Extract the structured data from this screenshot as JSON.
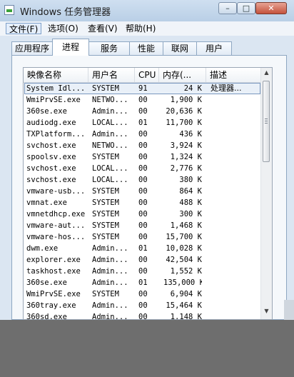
{
  "window": {
    "title": "Windows 任务管理器",
    "controls": {
      "minimize": "–",
      "maximize": "□",
      "close": "✕"
    }
  },
  "menu": [
    {
      "label": "文件(F)"
    },
    {
      "label": "选项(O)"
    },
    {
      "label": "查看(V)"
    },
    {
      "label": "帮助(H)"
    }
  ],
  "tabs": [
    {
      "label": "应用程序"
    },
    {
      "label": "进程"
    },
    {
      "label": "服务"
    },
    {
      "label": "性能"
    },
    {
      "label": "联网"
    },
    {
      "label": "用户"
    }
  ],
  "selected_tab": "进程",
  "columns": [
    {
      "label": "映像名称"
    },
    {
      "label": "用户名"
    },
    {
      "label": "CPU"
    },
    {
      "label": "内存(..."
    },
    {
      "label": "描述"
    }
  ],
  "processes": [
    {
      "name": "System Idl...",
      "user": "SYSTEM",
      "cpu": "91",
      "mem": "24 K",
      "desc": "处理器..."
    },
    {
      "name": "WmiPrvSE.exe",
      "user": "NETWO...",
      "cpu": "00",
      "mem": "1,900 K",
      "desc": ""
    },
    {
      "name": "360se.exe",
      "user": "Admin...",
      "cpu": "00",
      "mem": "20,636 K",
      "desc": ""
    },
    {
      "name": "audiodg.exe",
      "user": "LOCAL...",
      "cpu": "01",
      "mem": "11,700 K",
      "desc": ""
    },
    {
      "name": "TXPlatform...",
      "user": "Admin...",
      "cpu": "00",
      "mem": "436 K",
      "desc": ""
    },
    {
      "name": "svchost.exe",
      "user": "NETWO...",
      "cpu": "00",
      "mem": "3,924 K",
      "desc": ""
    },
    {
      "name": "spoolsv.exe",
      "user": "SYSTEM",
      "cpu": "00",
      "mem": "1,324 K",
      "desc": ""
    },
    {
      "name": "svchost.exe",
      "user": "LOCAL...",
      "cpu": "00",
      "mem": "2,776 K",
      "desc": ""
    },
    {
      "name": "svchost.exe",
      "user": "LOCAL...",
      "cpu": "00",
      "mem": "380 K",
      "desc": ""
    },
    {
      "name": "vmware-usb...",
      "user": "SYSTEM",
      "cpu": "00",
      "mem": "864 K",
      "desc": ""
    },
    {
      "name": "vmnat.exe",
      "user": "SYSTEM",
      "cpu": "00",
      "mem": "488 K",
      "desc": ""
    },
    {
      "name": "vmnetdhcp.exe",
      "user": "SYSTEM",
      "cpu": "00",
      "mem": "300 K",
      "desc": ""
    },
    {
      "name": "vmware-aut...",
      "user": "SYSTEM",
      "cpu": "00",
      "mem": "1,468 K",
      "desc": ""
    },
    {
      "name": "vmware-hos...",
      "user": "SYSTEM",
      "cpu": "00",
      "mem": "15,700 K",
      "desc": ""
    },
    {
      "name": "dwm.exe",
      "user": "Admin...",
      "cpu": "01",
      "mem": "10,028 K",
      "desc": ""
    },
    {
      "name": "explorer.exe",
      "user": "Admin...",
      "cpu": "00",
      "mem": "42,504 K",
      "desc": ""
    },
    {
      "name": "taskhost.exe",
      "user": "Admin...",
      "cpu": "00",
      "mem": "1,552 K",
      "desc": ""
    },
    {
      "name": "360se.exe",
      "user": "Admin...",
      "cpu": "01",
      "mem": "135,000 K",
      "desc": ""
    },
    {
      "name": "WmiPrvSE.exe",
      "user": "SYSTEM",
      "cpu": "00",
      "mem": "6,904 K",
      "desc": ""
    },
    {
      "name": "360tray.exe",
      "user": "Admin...",
      "cpu": "00",
      "mem": "15,464 K",
      "desc": ""
    },
    {
      "name": "360sd.exe",
      "user": "Admin...",
      "cpu": "00",
      "mem": "1,148 K",
      "desc": ""
    }
  ],
  "selected_process_index": 0,
  "icons": {
    "scroll_up": "▲",
    "scroll_down": "▼"
  }
}
